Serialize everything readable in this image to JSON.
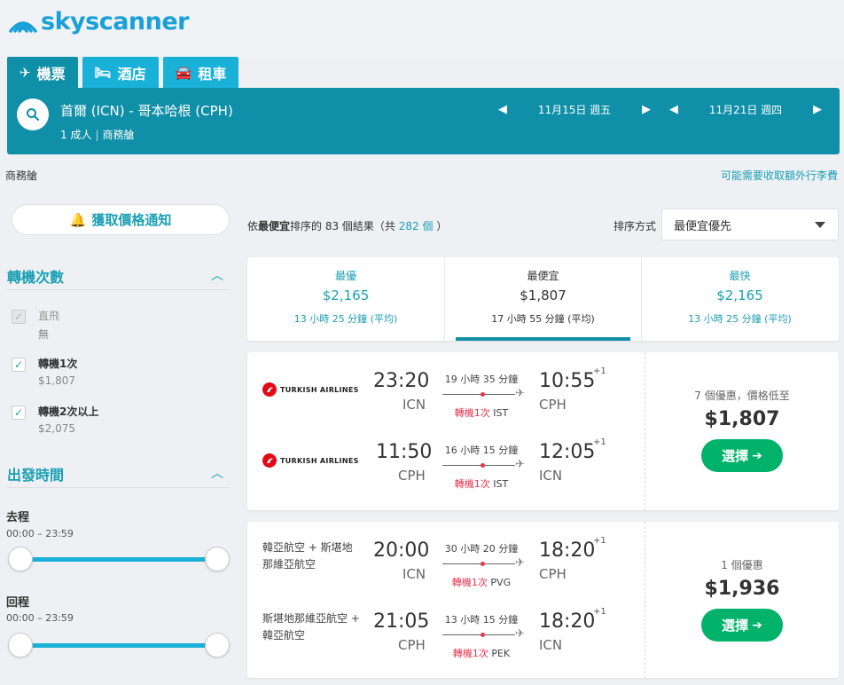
{
  "brand": {
    "name": "skyscanner"
  },
  "tabs": [
    {
      "label": "機票",
      "icon": "plane-icon",
      "active": true
    },
    {
      "label": "酒店",
      "icon": "bed-icon",
      "active": false
    },
    {
      "label": "租車",
      "icon": "car-icon",
      "active": false
    }
  ],
  "search": {
    "route": "首爾 (ICN) - 哥本哈根 (CPH)",
    "passengers": "1 成人",
    "cabin": "商務艙",
    "depart_date": "11月15日 週五",
    "return_date": "11月21日 週四"
  },
  "subheader": {
    "cabin_label": "商務艙",
    "baggage_link": "可能需要收取額外行李費"
  },
  "sidebar": {
    "alert_button": "獲取價格通知",
    "stops": {
      "title": "轉機次數",
      "items": [
        {
          "label": "直飛",
          "price": "無",
          "checked": true,
          "disabled": true
        },
        {
          "label": "轉機1次",
          "price": "$1,807",
          "checked": true,
          "disabled": false
        },
        {
          "label": "轉機2次以上",
          "price": "$2,075",
          "checked": true,
          "disabled": false
        }
      ]
    },
    "times": {
      "title": "出發時間",
      "outbound_label": "去程",
      "outbound_range": "00:00 – 23:59",
      "return_label": "回程",
      "return_range": "00:00 – 23:59"
    }
  },
  "results": {
    "prefix": "依",
    "sort_word": "最便宜",
    "mid": "排序的 83 個結果（共",
    "total": "282 個",
    "suffix": "）",
    "sort_label": "排序方式",
    "sort_value": "最便宜優先"
  },
  "summary": [
    {
      "title": "最優",
      "price": "$2,165",
      "duration": "13 小時 25 分鐘 (平均)",
      "active": false
    },
    {
      "title": "最便宜",
      "price": "$1,807",
      "duration": "17 小時 55 分鐘 (平均)",
      "active": true
    },
    {
      "title": "最快",
      "price": "$2,165",
      "duration": "13 小時 25 分鐘 (平均)",
      "active": false
    }
  ],
  "cards": [
    {
      "legs": [
        {
          "airline": "TURKISH AIRLINES",
          "logo": "turkish-airlines-logo",
          "dep_time": "23:20",
          "dep_code": "ICN",
          "duration": "19 小時 35 分鐘",
          "stops": "轉機1次",
          "via": "IST",
          "arr_time": "10:55",
          "arr_code": "CPH",
          "day_offset": "+1"
        },
        {
          "airline": "TURKISH AIRLINES",
          "logo": "turkish-airlines-logo",
          "dep_time": "11:50",
          "dep_code": "CPH",
          "duration": "16 小時 15 分鐘",
          "stops": "轉機1次",
          "via": "IST",
          "arr_time": "12:05",
          "arr_code": "ICN",
          "day_offset": "+1"
        }
      ],
      "deals": "7 個優惠，價格低至",
      "price": "$1,807",
      "button": "選擇"
    },
    {
      "legs": [
        {
          "airline": "韓亞航空 + 斯堪地那維亞航空",
          "logo": "",
          "dep_time": "20:00",
          "dep_code": "ICN",
          "duration": "30 小時 20 分鐘",
          "stops": "轉機1次",
          "via": "PVG",
          "arr_time": "18:20",
          "arr_code": "CPH",
          "day_offset": "+1"
        },
        {
          "airline": "斯堪地那維亞航空 + 韓亞航空",
          "logo": "",
          "dep_time": "21:05",
          "dep_code": "CPH",
          "duration": "13 小時 15 分鐘",
          "stops": "轉機1次",
          "via": "PEK",
          "arr_time": "18:20",
          "arr_code": "ICN",
          "day_offset": "+1"
        }
      ],
      "deals": "1 個優惠",
      "price": "$1,936",
      "button": "選擇"
    }
  ],
  "colors": {
    "teal_dark": "#0f8fa8",
    "teal": "#1ab1d8",
    "link": "#1a9fb4",
    "green": "#00b26a",
    "red": "#e8344e"
  }
}
